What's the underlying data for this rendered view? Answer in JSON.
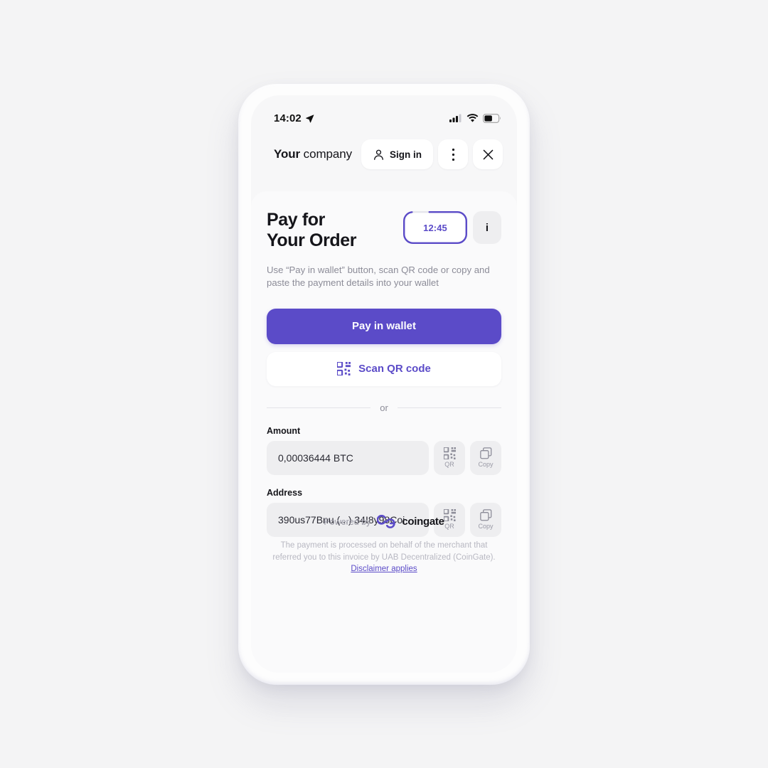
{
  "status_bar": {
    "time": "14:02",
    "location_icon": "location-arrow-icon",
    "signal_icon": "cellular-signal-icon",
    "wifi_icon": "wifi-icon",
    "battery_icon": "battery-icon"
  },
  "header": {
    "brand_bold": "Your",
    "brand_normal": " company",
    "sign_in_label": "Sign in",
    "sign_in_icon": "person-icon",
    "more_icon": "kebab-menu-icon",
    "close_icon": "close-icon"
  },
  "main": {
    "title": "Pay for\nYour Order",
    "title_line1": "Pay for",
    "title_line2": "Your Order",
    "timer": "12:45",
    "info_label": "i",
    "instructions": "Use “Pay in wallet” button, scan QR code or copy and paste the payment details into your wallet",
    "pay_button_label": "Pay in wallet",
    "scan_qr_label": "Scan QR code",
    "scan_qr_icon": "qr-code-icon",
    "divider_text": "or"
  },
  "fields": [
    {
      "label": "Amount",
      "value": "0,00036444 BTC",
      "qr_label": "QR",
      "copy_label": "Copy"
    },
    {
      "label": "Address",
      "value": "390us77Bnu (...) 34I8y98Coi",
      "qr_label": "QR",
      "copy_label": "Copy"
    }
  ],
  "footer": {
    "powered_by": "Powered by",
    "coingate_logo_icon": "coingate-logo-icon",
    "coingate_name": "coingate",
    "legal_line1": "The payment is processed on behalf of the merchant that",
    "legal_line2": "referred you to this invoice by UAB Decentralized",
    "legal_line3": "(CoinGate). ",
    "disclaimer_link": "Disclaimer applies"
  },
  "colors": {
    "brand_purple": "#5b4bc8",
    "page_background": "#f4f4f5",
    "card_background": "#fafafb",
    "field_background": "#eeeef0",
    "text_primary": "#15151a",
    "text_muted": "#8c8c98",
    "text_faint": "#b8b8c2"
  }
}
